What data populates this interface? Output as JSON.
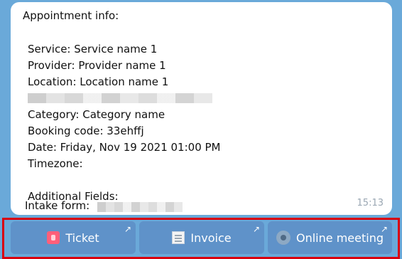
{
  "message": {
    "heading": "Appointment info:",
    "lines": [
      "Service: Service name 1",
      "Provider: Provider name 1",
      "Location: Location name 1",
      "",
      "Category: Category name",
      "Booking code: 33ehffj",
      "Date: Friday, Nov 19 2021 01:00 PM",
      "Timezone:",
      "",
      "Additional Fields:"
    ],
    "intake_label": "Intake form:",
    "time": "15:13"
  },
  "buttons": [
    {
      "label": "Ticket",
      "icon": "ticket-icon"
    },
    {
      "label": "Invoice",
      "icon": "invoice-icon"
    },
    {
      "label": "Online meeting",
      "icon": "meeting-icon"
    }
  ],
  "colors": {
    "background": "#6aa9d9",
    "bubble": "#ffffff",
    "button": "#5f92c9",
    "highlight": "#d8000f"
  }
}
